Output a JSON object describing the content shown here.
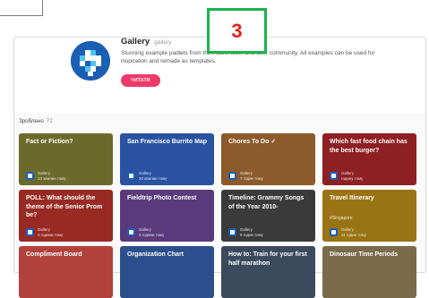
{
  "badge": {
    "number": "3"
  },
  "gallery": {
    "title": "Gallery",
    "subtitle": "gallery",
    "description": "Stunning example padlets from the Padlet team and user community. All examples can be used for inspiration and remade as templates.",
    "read_label": "ЧИТАТИ"
  },
  "made": {
    "label": "Зроблено",
    "count": "72"
  },
  "cards": [
    {
      "title": "Fact or Fiction?",
      "tag": "",
      "author": "Gallery",
      "time": "13 хвилин тому",
      "color": "#6b6a2c"
    },
    {
      "title": "San Francisco Burrito Map",
      "tag": "",
      "author": "Gallery",
      "time": "20 хвилин тому",
      "color": "#2a52a3"
    },
    {
      "title": "Chores To Do ✓",
      "tag": "",
      "author": "Gallery",
      "time": "7 годин тому",
      "color": "#8c5a2b"
    },
    {
      "title": "Which fast food chain has the best burger?",
      "tag": "",
      "author": "Gallery",
      "time": "годину тому",
      "color": "#8e1f23"
    },
    {
      "title": "POLL: What should the theme of the Senior Prom be?",
      "tag": "",
      "author": "Gallery",
      "time": "2 години тому",
      "color": "#982a23"
    },
    {
      "title": "Fieldtrip Photo Contest",
      "tag": "",
      "author": "Gallery",
      "time": "3 години тому",
      "color": "#5a3a7c"
    },
    {
      "title": "Timeline: Grammy Songs of the Year 2010-",
      "tag": "",
      "author": "Gallery",
      "time": "9 годин тому",
      "color": "#3a3a3a"
    },
    {
      "title": "Travel Itinerary",
      "tag": "#Singapore",
      "author": "Gallery",
      "time": "11 годин тому",
      "color": "#9a7414"
    },
    {
      "title": "Compliment Board",
      "tag": "",
      "author": "",
      "time": "",
      "color": "#b2413b"
    },
    {
      "title": "Organization Chart",
      "tag": "",
      "author": "",
      "time": "",
      "color": "#2b4f8c"
    },
    {
      "title": "How to: Train for your first half marathon",
      "tag": "",
      "author": "",
      "time": "",
      "color": "#3b4a5c"
    },
    {
      "title": "Dinosaur Time Periods",
      "tag": "",
      "author": "",
      "time": "",
      "color": "#7a6a4a"
    }
  ]
}
